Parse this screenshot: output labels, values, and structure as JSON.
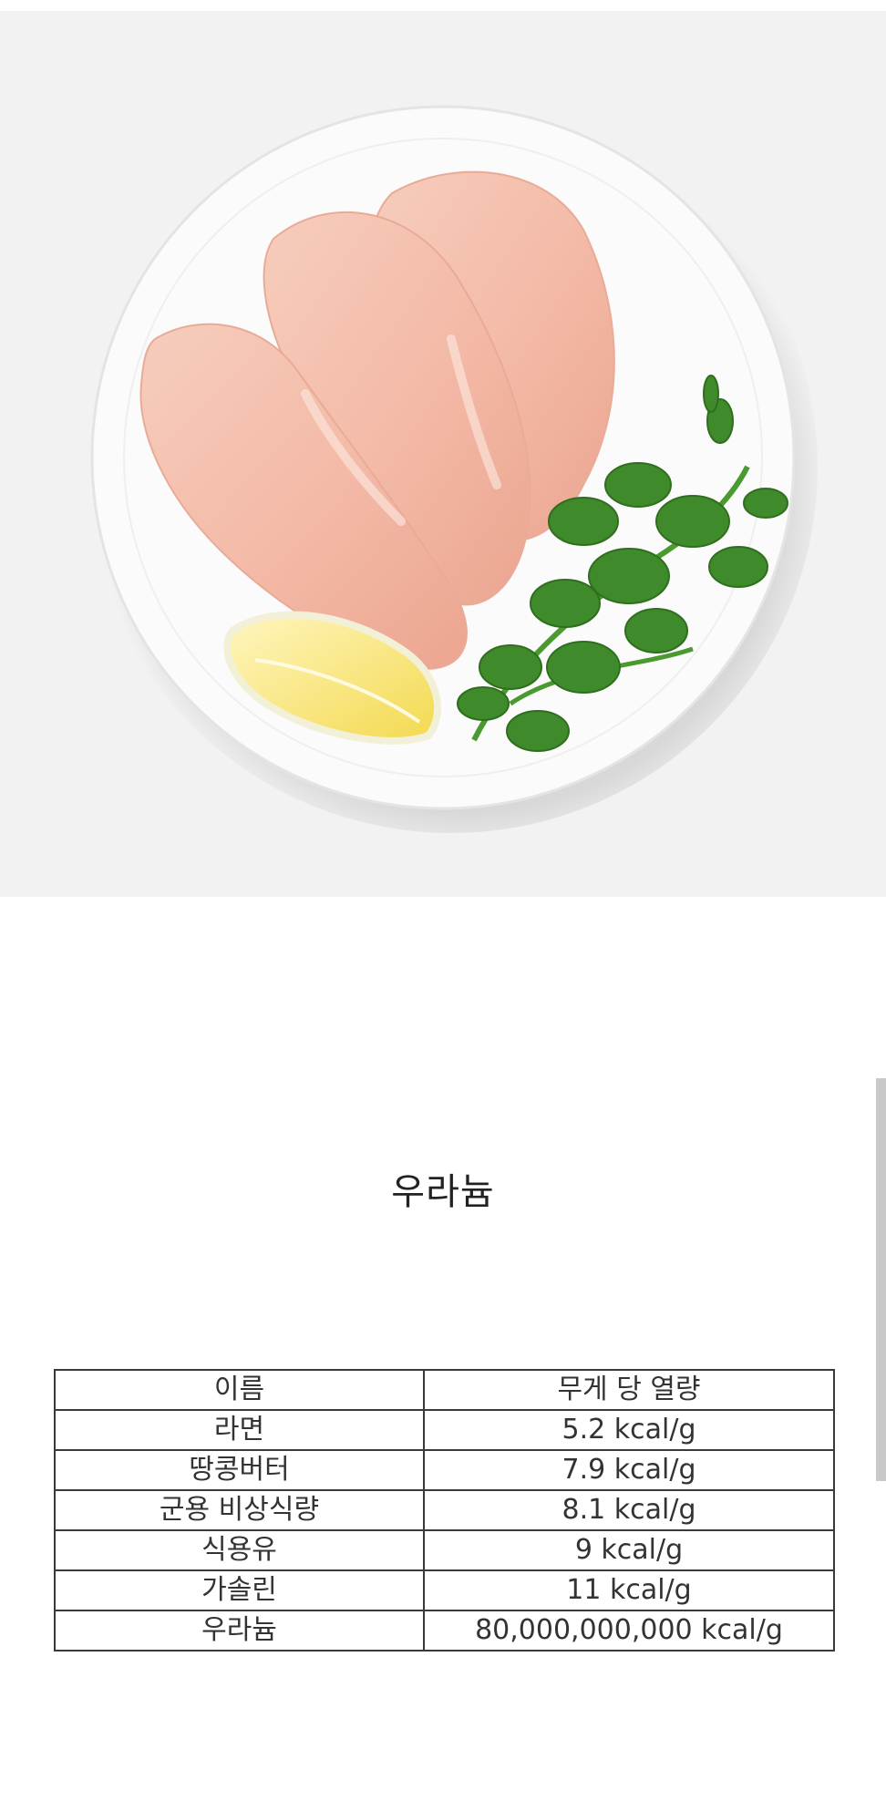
{
  "photo": {
    "subject": "chicken-breast-plate",
    "icons": [
      "chicken-breast-icon",
      "lemon-wedge-icon",
      "watercress-icon"
    ]
  },
  "heading": "우라늄",
  "table": {
    "headers": [
      "이름",
      "무게 당 열량"
    ],
    "rows": [
      [
        "라면",
        "5.2 kcal/g"
      ],
      [
        "땅콩버터",
        "7.9 kcal/g"
      ],
      [
        "군용 비상식량",
        "8.1 kcal/g"
      ],
      [
        "식용유",
        "9 kcal/g"
      ],
      [
        "가솔린",
        "11 kcal/g"
      ],
      [
        "우라늄",
        "80,000,000,000 kcal/g"
      ]
    ]
  },
  "colors": {
    "background": "#ffffff",
    "photo_background": "#f2f2f2",
    "table_border": "#3a3a3a",
    "text": "#333333"
  }
}
